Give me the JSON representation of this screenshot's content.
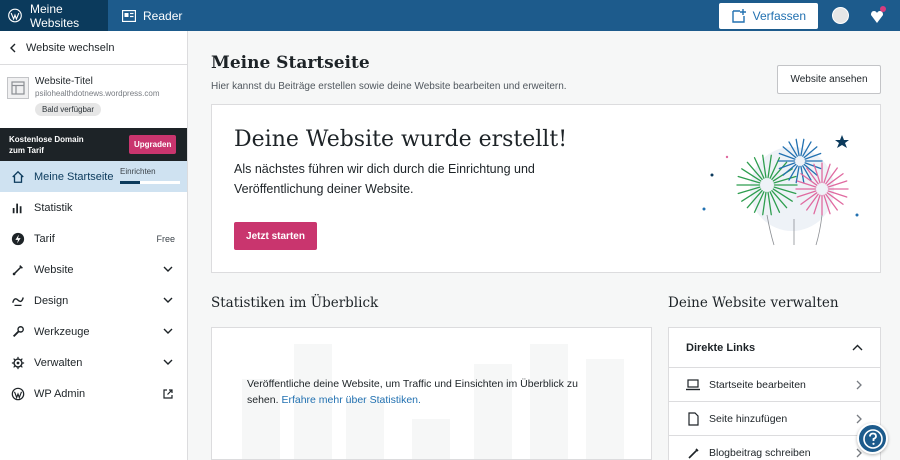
{
  "topbar": {
    "sites_label": "Meine Websites",
    "reader_label": "Reader",
    "write_label": "Verfassen"
  },
  "sidebar": {
    "switch_label": "Website wechseln",
    "site": {
      "title": "Website-Titel",
      "url": "psilohealthdotnews.wordpress.com",
      "badge": "Bald verfügbar"
    },
    "upsell": {
      "text_line1": "Kostenlose Domain",
      "text_line2": "zum Tarif",
      "button": "Upgraden"
    },
    "items": [
      {
        "label": "Meine Startseite",
        "icon": "home-icon",
        "active": true,
        "progress_label": "Einrichten",
        "progress": 0.33
      },
      {
        "label": "Statistik",
        "icon": "stats-icon"
      },
      {
        "label": "Tarif",
        "icon": "plan-icon",
        "right": "Free"
      },
      {
        "label": "Website",
        "icon": "brush-icon",
        "expandable": true
      },
      {
        "label": "Design",
        "icon": "design-icon",
        "expandable": true
      },
      {
        "label": "Werkzeuge",
        "icon": "tools-icon",
        "expandable": true
      },
      {
        "label": "Verwalten",
        "icon": "settings-icon",
        "expandable": true
      },
      {
        "label": "WP Admin",
        "icon": "wordpress-icon",
        "external": true
      }
    ]
  },
  "main": {
    "title": "Meine Startseite",
    "subtitle": "Hier kannst du Beiträge erstellen sowie deine Website bearbeiten und erweitern.",
    "view_site_button": "Website ansehen",
    "hero": {
      "title": "Deine Website wurde erstellt!",
      "text": "Als nächstes führen wir dich durch die Einrichtung und Veröffentlichung deiner Website.",
      "button": "Jetzt starten"
    },
    "stats": {
      "title": "Statistiken im Überblick",
      "text": "Veröffentliche deine Website, um Traffic und Einsichten im Überblick zu sehen.",
      "link": "Erfahre mehr über Statistiken."
    },
    "manage": {
      "title": "Deine Website verwalten",
      "card_title": "Direkte Links",
      "links": [
        {
          "label": "Startseite bearbeiten",
          "icon": "laptop-icon"
        },
        {
          "label": "Seite hinzufügen",
          "icon": "page-icon"
        },
        {
          "label": "Blogbeitrag schreiben",
          "icon": "pencil-icon"
        }
      ]
    }
  },
  "colors": {
    "topbar": "#1d5b8c",
    "topbar_dark": "#0b3a5c",
    "accent_pink": "#c9356e",
    "active_bg": "#cfe2f1",
    "link_blue": "#2271b1"
  }
}
